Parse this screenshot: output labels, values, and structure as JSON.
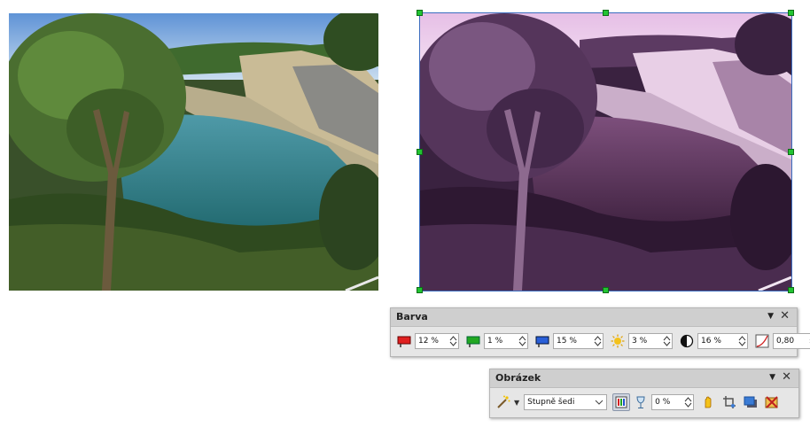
{
  "color_toolbar": {
    "title": "Barva",
    "red": "12 %",
    "green": "1 %",
    "blue": "15 %",
    "brightness": "3 %",
    "contrast": "16 %",
    "gamma": "0,80"
  },
  "image_toolbar": {
    "title": "Obrázek",
    "graphics_mode": "Stupně šedi",
    "transparency": "0 %"
  }
}
